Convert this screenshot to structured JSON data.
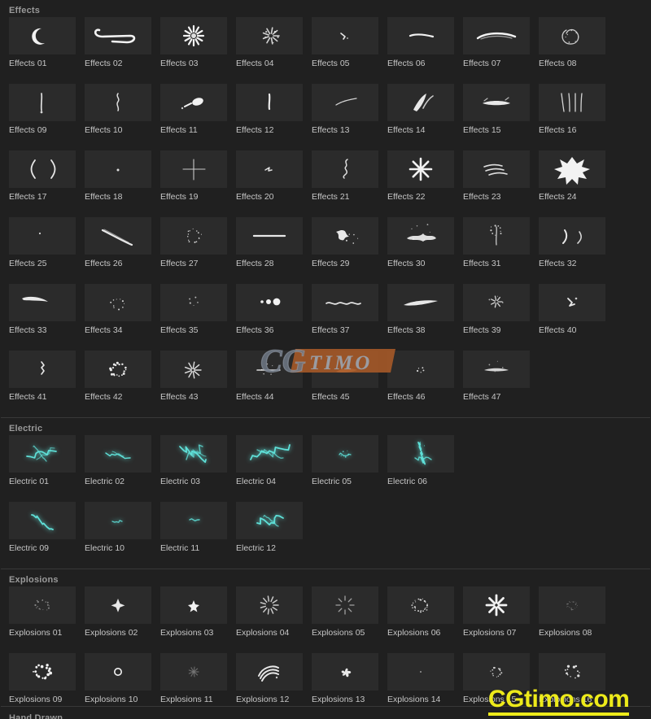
{
  "theme": {
    "page_bg": "#202020",
    "tile_bg": "#2b2b2b",
    "header_text": "#9a9a9a",
    "label_text": "#c6c6c6",
    "divider": "#383838",
    "electric_accent": "#5fe0d8",
    "watermark_yellow": "#edea1a",
    "logo_orange": "#a85a28",
    "logo_gray": "#7d8793"
  },
  "watermarks": {
    "center_logo": {
      "cg": "CG",
      "timo": "TIMO"
    },
    "bottom_right": "CGtimo.com"
  },
  "sections": [
    {
      "name": "effects",
      "header": "Effects",
      "columns": 8,
      "items": [
        {
          "label": "Effects 01",
          "art": "crescent"
        },
        {
          "label": "Effects 02",
          "art": "swoosh-loop"
        },
        {
          "label": "Effects 03",
          "art": "burst-spikes"
        },
        {
          "label": "Effects 04",
          "art": "burst-small"
        },
        {
          "label": "Effects 05",
          "art": "flick-tiny"
        },
        {
          "label": "Effects 06",
          "art": "streak-short"
        },
        {
          "label": "Effects 07",
          "art": "streak-long"
        },
        {
          "label": "Effects 08",
          "art": "scribble-ring"
        },
        {
          "label": "Effects 09",
          "art": "drip-vertical"
        },
        {
          "label": "Effects 10",
          "art": "squiggle-vertical"
        },
        {
          "label": "Effects 11",
          "art": "blob-dash"
        },
        {
          "label": "Effects 12",
          "art": "tick-vertical"
        },
        {
          "label": "Effects 13",
          "art": "hairline-diag"
        },
        {
          "label": "Effects 14",
          "art": "twin-streaks"
        },
        {
          "label": "Effects 15",
          "art": "flat-splash"
        },
        {
          "label": "Effects 16",
          "art": "four-lines"
        },
        {
          "label": "Effects 17",
          "art": "parentheses"
        },
        {
          "label": "Effects 18",
          "art": "dot-single"
        },
        {
          "label": "Effects 19",
          "art": "cross-thin"
        },
        {
          "label": "Effects 20",
          "art": "check-small"
        },
        {
          "label": "Effects 21",
          "art": "zigzag-vertical"
        },
        {
          "label": "Effects 22",
          "art": "star-burst"
        },
        {
          "label": "Effects 23",
          "art": "speed-lines"
        },
        {
          "label": "Effects 24",
          "art": "comic-flash"
        },
        {
          "label": "Effects 25",
          "art": "dot-tiny"
        },
        {
          "label": "Effects 26",
          "art": "arc-sweep"
        },
        {
          "label": "Effects 27",
          "art": "dot-ring"
        },
        {
          "label": "Effects 28",
          "art": "dash-line"
        },
        {
          "label": "Effects 29",
          "art": "splatter-left"
        },
        {
          "label": "Effects 30",
          "art": "splatter-wide"
        },
        {
          "label": "Effects 31",
          "art": "spray-up"
        },
        {
          "label": "Effects 32",
          "art": "arc-pair"
        },
        {
          "label": "Effects 33",
          "art": "swoop-tail"
        },
        {
          "label": "Effects 34",
          "art": "specks-column"
        },
        {
          "label": "Effects 35",
          "art": "specks-few"
        },
        {
          "label": "Effects 36",
          "art": "three-dots"
        },
        {
          "label": "Effects 37",
          "art": "wave-line"
        },
        {
          "label": "Effects 38",
          "art": "brush-stroke"
        },
        {
          "label": "Effects 39",
          "art": "spark-small"
        },
        {
          "label": "Effects 40",
          "art": "spark-pair"
        },
        {
          "label": "Effects 41",
          "art": "spark-column"
        },
        {
          "label": "Effects 42",
          "art": "dot-cluster"
        },
        {
          "label": "Effects 43",
          "art": "fan-lines"
        },
        {
          "label": "Effects 44",
          "art": "dash-row"
        },
        {
          "label": "Effects 45",
          "art": "stroke-tan"
        },
        {
          "label": "Effects 46",
          "art": "specks-pair"
        },
        {
          "label": "Effects 47",
          "art": "smudge-wide"
        }
      ]
    },
    {
      "name": "electric",
      "header": "Electric",
      "columns": 8,
      "rows": [
        6,
        4
      ],
      "items": [
        {
          "label": "Electric 01",
          "art": "bolt-web"
        },
        {
          "label": "Electric 02",
          "art": "bolt-thin"
        },
        {
          "label": "Electric 03",
          "art": "bolt-branch"
        },
        {
          "label": "Electric 04",
          "art": "bolt-long"
        },
        {
          "label": "Electric 05",
          "art": "bolt-tiny"
        },
        {
          "label": "Electric 06",
          "art": "bolt-tall"
        },
        {
          "label": "Electric 09",
          "art": "bolt-zigzag"
        },
        {
          "label": "Electric 10",
          "art": "bolt-spark"
        },
        {
          "label": "Electric 11",
          "art": "bolt-dot"
        },
        {
          "label": "Electric 12",
          "art": "bolt-wide"
        }
      ]
    },
    {
      "name": "explosions",
      "header": "Explosions",
      "columns": 8,
      "items": [
        {
          "label": "Explosions 01",
          "art": "ring-dots-faint"
        },
        {
          "label": "Explosions 02",
          "art": "plus-star"
        },
        {
          "label": "Explosions 03",
          "art": "star-solid"
        },
        {
          "label": "Explosions 04",
          "art": "burst-dashes"
        },
        {
          "label": "Explosions 05",
          "art": "burst-sparse"
        },
        {
          "label": "Explosions 06",
          "art": "ring-dense"
        },
        {
          "label": "Explosions 07",
          "art": "radial-rays"
        },
        {
          "label": "Explosions 08",
          "art": "ring-faint-small"
        },
        {
          "label": "Explosions 09",
          "art": "ring-dots-bold"
        },
        {
          "label": "Explosions 10",
          "art": "circle-outline"
        },
        {
          "label": "Explosions 11",
          "art": "asterisk-faint"
        },
        {
          "label": "Explosions 12",
          "art": "arc-stack"
        },
        {
          "label": "Explosions 13",
          "art": "pinwheel"
        },
        {
          "label": "Explosions 14",
          "art": "dot-micro"
        },
        {
          "label": "Explosions 15",
          "art": "ring-dots-mid"
        },
        {
          "label": "Explosions 16",
          "art": "ring-dots-loose"
        }
      ]
    },
    {
      "name": "next-partial",
      "header": "Hand Drawn",
      "columns": 8,
      "items": []
    }
  ]
}
